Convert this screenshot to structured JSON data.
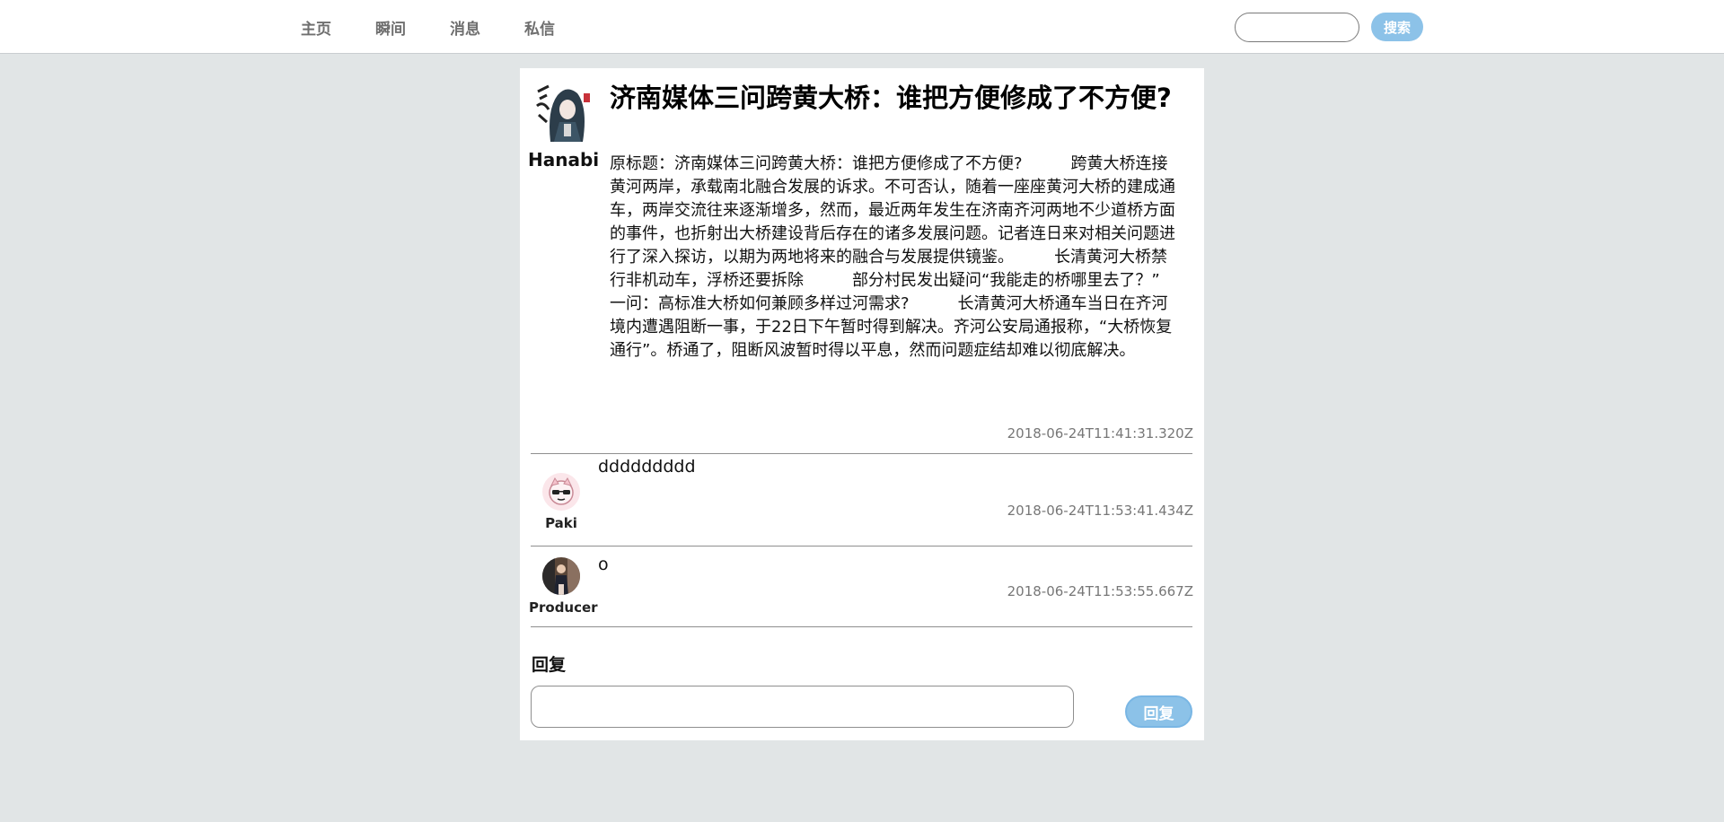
{
  "nav": {
    "links": [
      "主页",
      "瞬间",
      "消息",
      "私信"
    ],
    "search_placeholder": "",
    "search_button": "搜索"
  },
  "post": {
    "author": "Hanabi",
    "title": "济南媒体三问跨黄大桥：谁把方便修成了不方便?",
    "body": "原标题：济南媒体三问跨黄大桥：谁把方便修成了不方便?　　　跨黄大桥连接黄河两岸，承载南北融合发展的诉求。不可否认，随着一座座黄河大桥的建成通车，两岸交流往来逐渐增多，然而，最近两年发生在济南齐河两地不少道桥方面的事件，也折射出大桥建设背后存在的诸多发展问题。记者连日来对相关问题进行了深入探访，以期为两地将来的融合与发展提供镜鉴。　　　长清黄河大桥禁行非机动车，浮桥还要拆除　　　部分村民发出疑问“我能走的桥哪里去了？”　　　一问：高标准大桥如何兼顾多样过河需求?　　　长清黄河大桥通车当日在齐河境内遭遇阻断一事，于22日下午暂时得到解决。齐河公安局通报称，“大桥恢复通行”。桥通了，阻断风波暂时得以平息，然而问题症结却难以彻底解决。",
    "timestamp": "2018-06-24T11:41:31.320Z"
  },
  "comments": [
    {
      "author": "Paki",
      "text": "ddddddddd",
      "timestamp": "2018-06-24T11:53:41.434Z"
    },
    {
      "author": "Producer",
      "text": "o",
      "timestamp": "2018-06-24T11:53:55.667Z"
    }
  ],
  "reply": {
    "heading": "回复",
    "placeholder": "",
    "button": "回复"
  },
  "colors": {
    "page_bg": "#e1e5e6",
    "accent": "#8cc2e8",
    "muted_text": "#777777"
  }
}
